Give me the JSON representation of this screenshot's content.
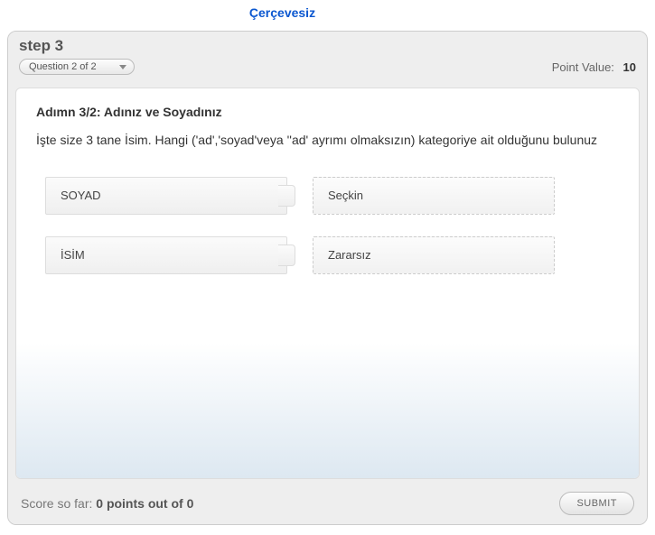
{
  "topLink": "Çerçevesiz",
  "header": {
    "stepTitle": "step 3",
    "questionSelector": "Question 2 of 2",
    "pointValueLabel": "Point Value:",
    "pointValue": "10"
  },
  "question": {
    "title": "Adımn 3/2: Adınız ve Soyadınız",
    "text": "İşte size 3 tane İsim. Hangi ('ad','soyad'veya ''ad' ayrımı olmaksızın) kategoriye ait olduğunu bulunuz"
  },
  "pairs": [
    {
      "slot": "SOYAD",
      "tile": "Seçkin"
    },
    {
      "slot": "İSİM",
      "tile": "Zararsız"
    }
  ],
  "footer": {
    "scoreLabel": "Score so far:",
    "scoreValue": "0 points out of 0",
    "submit": "SUBMIT"
  }
}
